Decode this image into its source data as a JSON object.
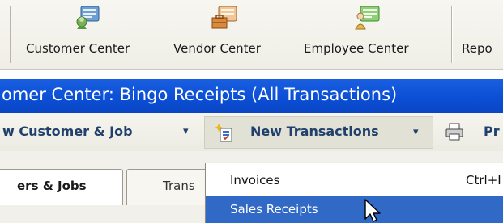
{
  "toolbar_icons": [
    {
      "label": "Customer Center",
      "icon": "customer-center-icon"
    },
    {
      "label": "Vendor Center",
      "icon": "vendor-center-icon"
    },
    {
      "label": "Employee Center",
      "icon": "employee-center-icon"
    },
    {
      "label": "Repo",
      "icon": ""
    }
  ],
  "title_bar": {
    "text": "omer Center: Bingo Receipts (All Transactions)"
  },
  "toolbar": {
    "new_customer_job": "w Customer & Job",
    "dropdown_arrow": "▾",
    "new_transactions_pre": "New ",
    "new_transactions_u": "T",
    "new_transactions_post": "ransactions",
    "print_partial": "Pr"
  },
  "tabs": [
    {
      "label_pre": "ers & ",
      "label_u": "J",
      "label_post": "obs"
    },
    {
      "label": "Trans"
    }
  ],
  "menu": {
    "items": [
      {
        "label": "Invoices",
        "shortcut": "Ctrl+I"
      },
      {
        "label": "Sales Receipts",
        "shortcut": ""
      }
    ]
  },
  "colors": {
    "title_bar": "#0b4fd6",
    "highlight": "#3169c6",
    "toolbar_text": "#21406b"
  }
}
